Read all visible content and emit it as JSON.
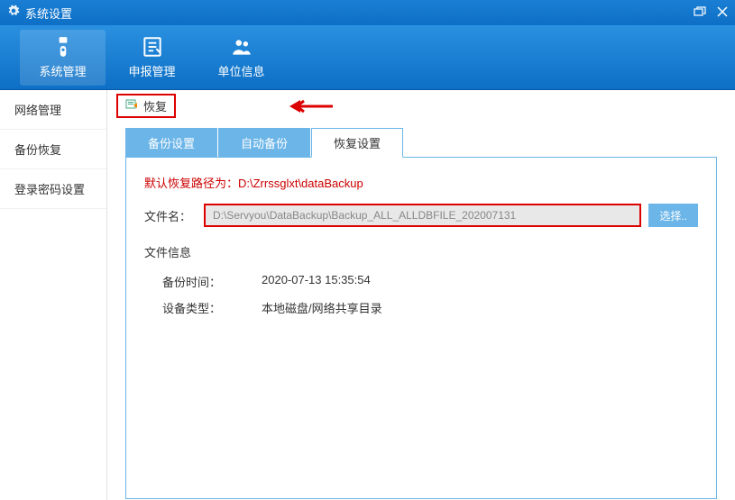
{
  "titlebar": {
    "title": "系统设置"
  },
  "toolbar": {
    "items": [
      {
        "label": "系统管理"
      },
      {
        "label": "申报管理"
      },
      {
        "label": "单位信息"
      }
    ]
  },
  "sidebar": {
    "items": [
      {
        "label": "网络管理"
      },
      {
        "label": "备份恢复"
      },
      {
        "label": "登录密码设置"
      }
    ]
  },
  "content": {
    "restore_btn": "恢复",
    "tabs": [
      {
        "label": "备份设置"
      },
      {
        "label": "自动备份"
      },
      {
        "label": "恢复设置"
      }
    ],
    "hint": "默认恢复路径为：D:\\Zrrssglxt\\dataBackup",
    "file_label": "文件名：",
    "file_value": "D:\\Servyou\\DataBackup\\Backup_ALL_ALLDBFILE_202007131",
    "select_btn": "选择..",
    "info_title": "文件信息",
    "rows": [
      {
        "key": "备份时间：",
        "val": "2020-07-13 15:35:54"
      },
      {
        "key": "设备类型：",
        "val": "本地磁盘/网络共享目录"
      }
    ]
  }
}
